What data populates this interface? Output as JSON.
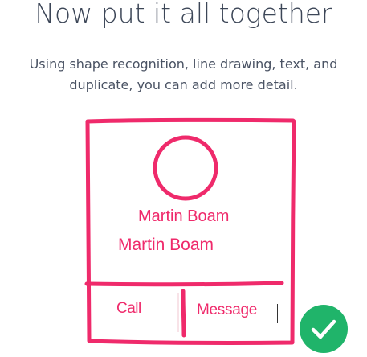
{
  "heading": {
    "title": "Now put it all together",
    "subtitle": "Using shape recognition, line drawing, text, and duplicate, you can add more detail."
  },
  "sketch": {
    "stroke_color": "#ef2a6b",
    "name_primary": "Martin Boam",
    "name_duplicate": "Martin Boam",
    "call_label": "Call",
    "message_label": "Message"
  },
  "badge": {
    "icon": "checkmark-icon",
    "color": "#20b46a"
  }
}
